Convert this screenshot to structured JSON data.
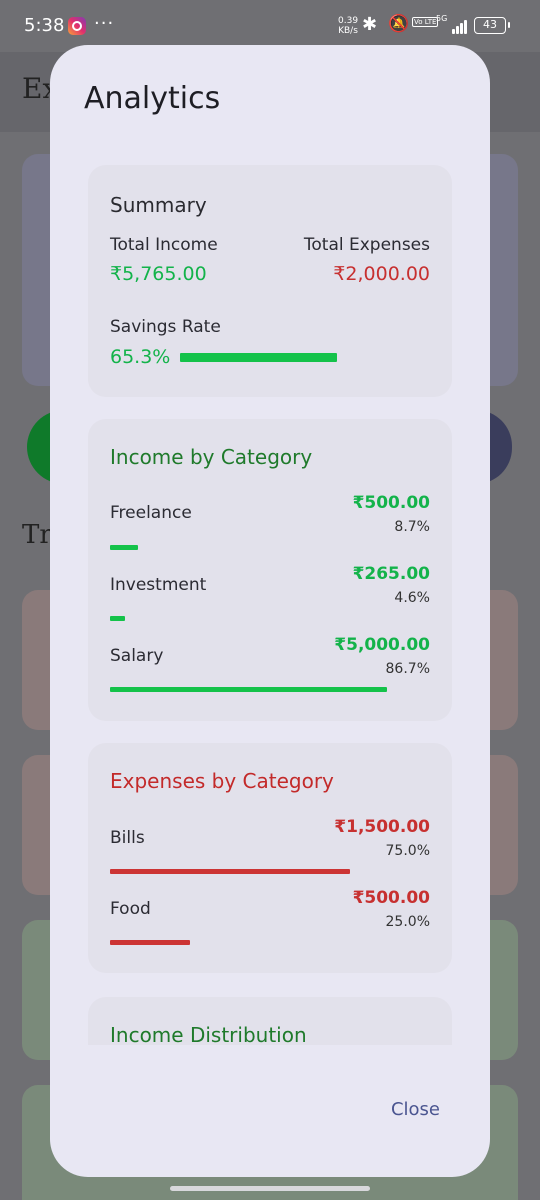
{
  "status_bar": {
    "time": "5:38",
    "more": "···",
    "net_speed_value": "0.39",
    "net_speed_unit": "KB/s",
    "volte": "Vo LTE",
    "network": "5G",
    "battery": "43"
  },
  "background": {
    "title": "Ex",
    "section": "Tr"
  },
  "dialog": {
    "title": "Analytics",
    "close_label": "Close",
    "summary": {
      "title": "Summary",
      "total_income_label": "Total Income",
      "total_income_value": "₹5,765.00",
      "total_expenses_label": "Total Expenses",
      "total_expenses_value": "₹2,000.00",
      "savings_rate_label": "Savings Rate",
      "savings_rate_value": "65.3%",
      "savings_rate_fraction": 0.653
    },
    "income_by_category": {
      "title": "Income by Category",
      "items": [
        {
          "label": "Freelance",
          "amount": "₹500.00",
          "percent": "8.7%",
          "fraction": 0.087
        },
        {
          "label": "Investment",
          "amount": "₹265.00",
          "percent": "4.6%",
          "fraction": 0.046
        },
        {
          "label": "Salary",
          "amount": "₹5,000.00",
          "percent": "86.7%",
          "fraction": 0.867
        }
      ]
    },
    "expenses_by_category": {
      "title": "Expenses by Category",
      "items": [
        {
          "label": "Bills",
          "amount": "₹1,500.00",
          "percent": "75.0%",
          "fraction": 0.75
        },
        {
          "label": "Food",
          "amount": "₹500.00",
          "percent": "25.0%",
          "fraction": 0.25
        }
      ]
    },
    "income_distribution": {
      "title": "Income Distribution"
    }
  },
  "colors": {
    "income_green": "#13b34a",
    "expense_red": "#c73030",
    "income_title_green": "#1f7a2b",
    "dialog_bg": "#e8e7f3",
    "card_bg": "#e2e1eb",
    "scrim": "#6f6f73"
  }
}
